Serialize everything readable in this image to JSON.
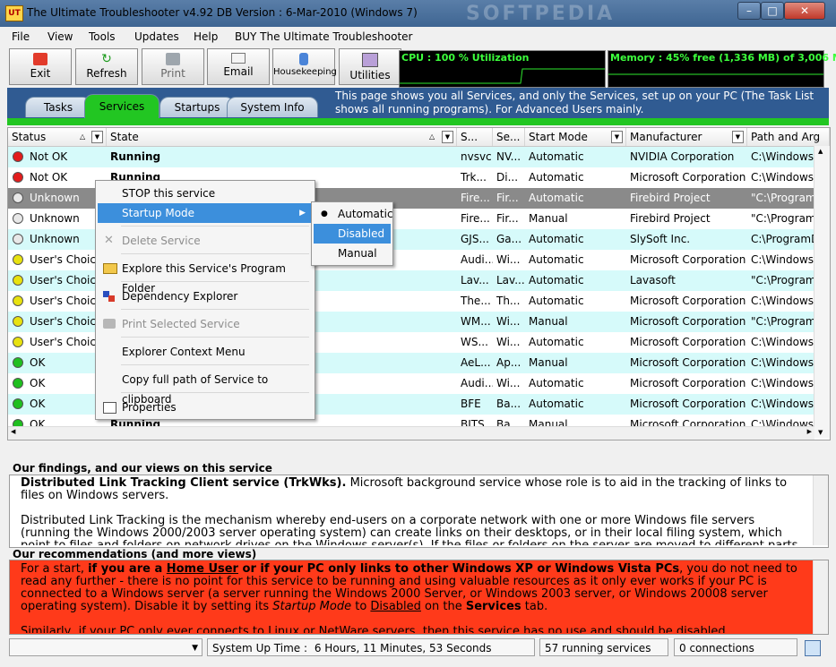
{
  "window": {
    "title": "The Ultimate Troubleshooter  v4.92    DB Version :  6-Mar-2010    (Windows 7)",
    "watermark": "SOFTPEDIA"
  },
  "menubar": [
    "File",
    "View",
    "Tools",
    "Updates",
    "Help",
    "BUY The Ultimate Troubleshooter"
  ],
  "toolbar": {
    "buttons": [
      "Exit",
      "Refresh",
      "Print",
      "Email",
      "Housekeeping",
      "Utilities"
    ],
    "cpu": "CPU :  100 % Utilization",
    "memory": "Memory :  45% free  (1,336 MB) of 3,006 MB"
  },
  "tabs": [
    "Tasks",
    "Services",
    "Startups",
    "System Info"
  ],
  "tab_info": "This page shows you all Services, and only the Services, set up on your PC (The Task List shows all running programs).  For Advanced Users mainly.",
  "table": {
    "headers": [
      "Status",
      "State",
      "S...",
      "Se...",
      "Start Mode",
      "Manufacturer",
      "Path and Arg"
    ],
    "rows": [
      {
        "status": "Not OK",
        "state": "Running",
        "s": "nvsvc",
        "se": "NV...",
        "mode": "Automatic",
        "mfr": "NVIDIA Corporation",
        "path": "C:\\Windows\\"
      },
      {
        "status": "Not OK",
        "state": "Running",
        "s": "Trk...",
        "se": "Di...",
        "mode": "Automatic",
        "mfr": "Microsoft Corporation",
        "path": "C:\\Windows\\"
      },
      {
        "status": "Unknown",
        "state": "",
        "s": "Fire...",
        "se": "Fir...",
        "mode": "Automatic",
        "mfr": "Firebird Project",
        "path": "\"C:\\Program"
      },
      {
        "status": "Unknown",
        "state": "",
        "s": "Fire...",
        "se": "Fir...",
        "mode": "Manual",
        "mfr": "Firebird Project",
        "path": "\"C:\\Program"
      },
      {
        "status": "Unknown",
        "state": "",
        "s": "GJS...",
        "se": "Ga...",
        "mode": "Automatic",
        "mfr": "SlySoft Inc.",
        "path": "C:\\ProgramD"
      },
      {
        "status": "User's Choice",
        "state": "",
        "s": "Audi...",
        "se": "Wi...",
        "mode": "Automatic",
        "mfr": "Microsoft Corporation",
        "path": "C:\\Windows\\"
      },
      {
        "status": "User's Choice",
        "state": "",
        "s": "Lav...",
        "se": "Lav...",
        "mode": "Automatic",
        "mfr": "Lavasoft",
        "path": "\"C:\\Program"
      },
      {
        "status": "User's Choice",
        "state": "",
        "s": "The...",
        "se": "Th...",
        "mode": "Automatic",
        "mfr": "Microsoft Corporation",
        "path": "C:\\Windows\\"
      },
      {
        "status": "User's Choice",
        "state": "",
        "s": "WM...",
        "se": "Wi...",
        "mode": "Manual",
        "mfr": "Microsoft Corporation",
        "path": "\"C:\\Program"
      },
      {
        "status": "User's Choice",
        "state": "",
        "s": "WS...",
        "se": "Wi...",
        "mode": "Automatic",
        "mfr": "Microsoft Corporation",
        "path": "C:\\Windows\\"
      },
      {
        "status": "OK",
        "state": "",
        "s": "AeL...",
        "se": "Ap...",
        "mode": "Manual",
        "mfr": "Microsoft Corporation",
        "path": "C:\\Windows\\"
      },
      {
        "status": "OK",
        "state": "",
        "s": "Audi...",
        "se": "Wi...",
        "mode": "Automatic",
        "mfr": "Microsoft Corporation",
        "path": "C:\\Windows\\"
      },
      {
        "status": "OK",
        "state": "",
        "s": "BFE",
        "se": "Ba...",
        "mode": "Automatic",
        "mfr": "Microsoft Corporation",
        "path": "C:\\Windows\\"
      },
      {
        "status": "OK",
        "state": "Running",
        "s": "BITS",
        "se": "Ba...",
        "mode": "Manual",
        "mfr": "Microsoft Corporation",
        "path": "C:\\Windows\\"
      }
    ]
  },
  "context_menu": {
    "items": [
      "STOP this service",
      "Startup Mode",
      "Delete Service",
      "Explore this Service's Program Folder",
      "Dependency Explorer",
      "Print Selected Service",
      "Explorer Context Menu",
      "Copy full path of Service to clipboard",
      "Properties"
    ],
    "submenu": [
      "Automatic",
      "Disabled",
      "Manual"
    ]
  },
  "findings": {
    "title": "Our findings, and our views on this service",
    "heading": "Distributed Link Tracking Client service (TrkWks).",
    "text1": "  Microsoft background service whose role is to aid in the tracking of links to files on Windows servers.",
    "text2": "Distributed Link Tracking is the mechanism whereby end-users on a corporate network with one or more Windows file servers (running the Windows 2000/2003 server operating system) can create links on their desktops, or in their local filing system, which point to files and folders on network drives on the Windows server(s).  If the files or folders on the server are moved to different parts of the server, or to"
  },
  "recommendations": {
    "title": "Our recommendations (and more views)",
    "p1_a": "For a start, ",
    "p1_b": "if you are a ",
    "p1_c": "Home User",
    "p1_d": " or if your PC only links to other Windows XP or Windows Vista PCs",
    "p1_e": ", you do not need to read any further - there is no point for this service to be running and using valuable resources as it only ever works if your PC is connected to a Windows server (a server running the Windows 2000 Server, or Windows 2003 server, or Windows 20008 server operating system).  Disable it by setting its  ",
    "p1_f": "Startup Mode",
    "p1_g": "  to  ",
    "p1_h": "Disabled",
    "p1_i": "  on the  ",
    "p1_j": "Services",
    "p1_k": "  tab.",
    "p2": "Similarly, if your PC only ever connects to Linux or NetWare servers, then this service has no use and should be disabled."
  },
  "statusbar": {
    "uptime_label": "System Up Time :",
    "uptime_value": "6 Hours, 11 Minutes, 53 Seconds",
    "running": "57 running services",
    "connections": "0 connections"
  }
}
